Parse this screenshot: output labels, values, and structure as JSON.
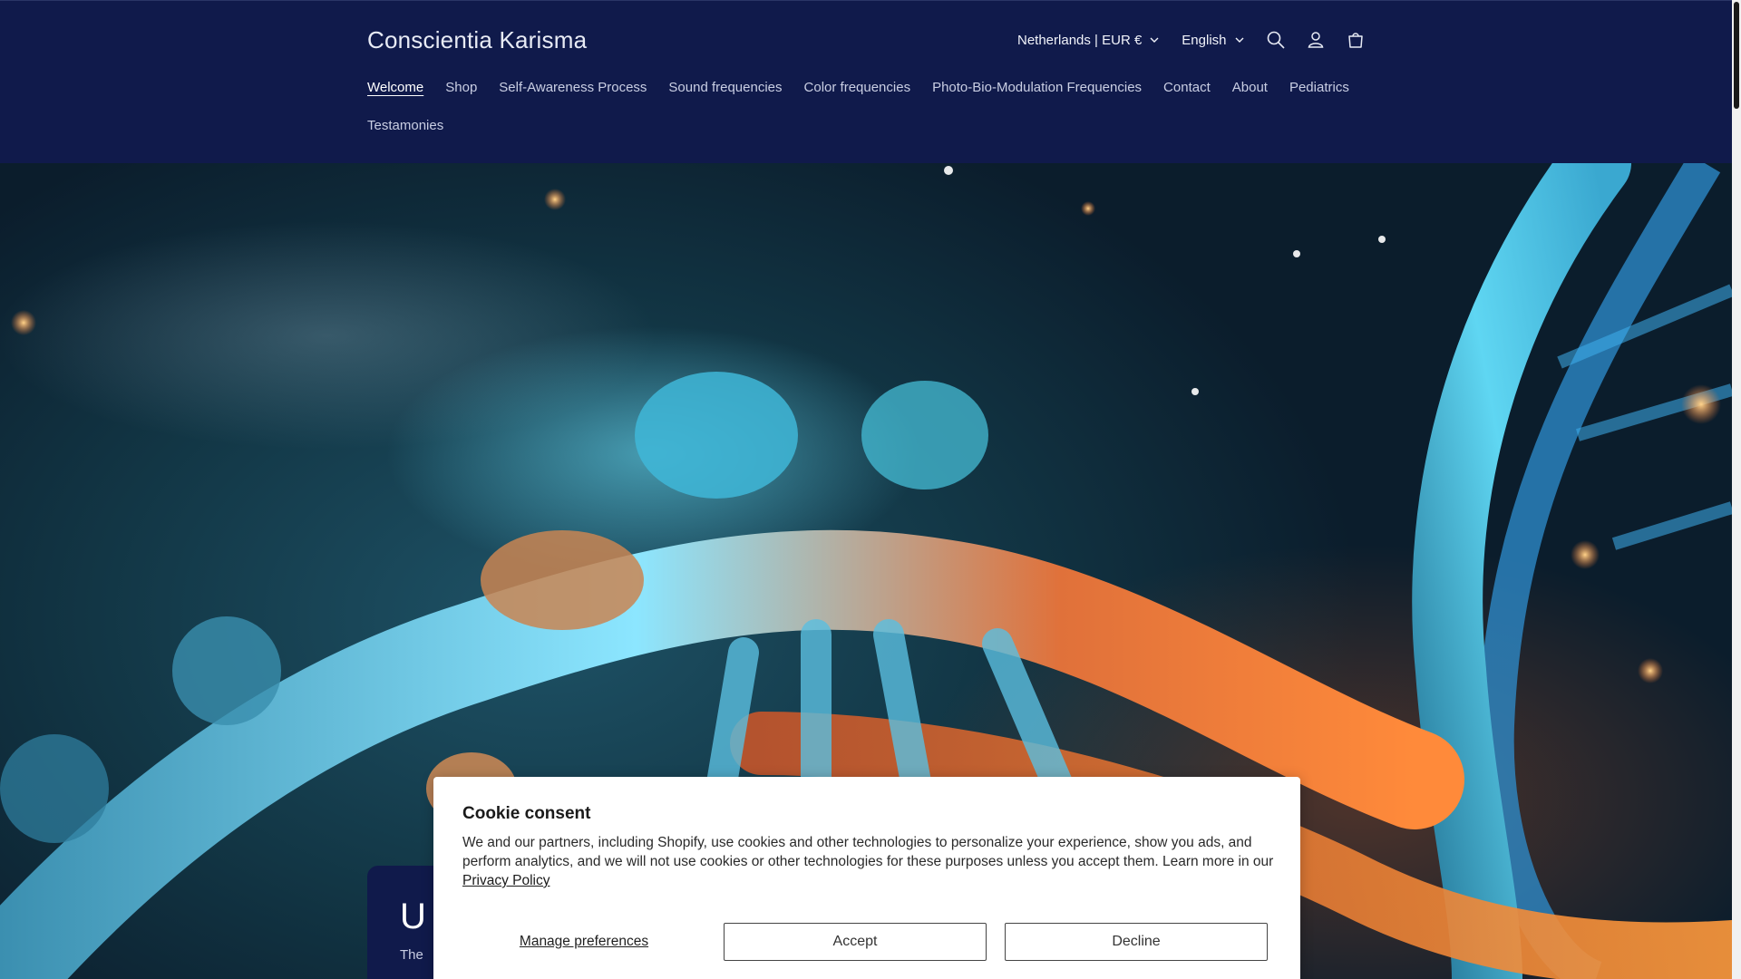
{
  "header": {
    "logo": "Conscientia Karisma",
    "country_selector": "Netherlands | EUR €",
    "language_selector": "English",
    "icons": [
      "search-icon",
      "account-icon",
      "cart-icon"
    ]
  },
  "nav": {
    "items": [
      {
        "label": "Welcome",
        "active": true
      },
      {
        "label": "Shop"
      },
      {
        "label": "Self-Awareness Process"
      },
      {
        "label": "Sound frequencies"
      },
      {
        "label": "Color frequencies"
      },
      {
        "label": "Photo-Bio-Modulation Frequencies"
      },
      {
        "label": "Contact"
      },
      {
        "label": "About"
      },
      {
        "label": "Pediatrics"
      },
      {
        "label": "Testamonies"
      }
    ]
  },
  "hero": {
    "title_fragment": "U",
    "text_fragment": "The"
  },
  "cookie": {
    "title": "Cookie consent",
    "body": "We and our partners, including Shopify, use cookies and other technologies to personalize your experience, show you ads, and perform analytics, and we will not use cookies or other technologies for these purposes unless you accept them. Learn more in our",
    "link": "Privacy Policy",
    "manage_label": "Manage preferences",
    "accept_label": "Accept",
    "decline_label": "Decline"
  },
  "colors": {
    "header_bg": "#101a4b",
    "hero_cyan": "#4fd4ff",
    "hero_orange": "#ff7a2e"
  }
}
